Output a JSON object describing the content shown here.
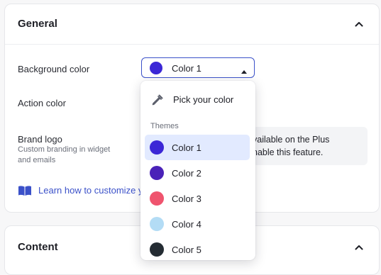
{
  "general": {
    "title": "General",
    "background_color": {
      "label": "Background color",
      "selected": "Color 1",
      "selected_hex": "#3b27d6"
    },
    "action_color": {
      "label": "Action color"
    },
    "brand_logo": {
      "label": "Brand logo",
      "sublabel": "Custom branding in widget and emails"
    },
    "upsell": {
      "line1": "vailable on the Plus",
      "line2": "nable this feature."
    },
    "learn_link": "Learn how to customize y"
  },
  "content": {
    "title": "Content"
  },
  "dropdown": {
    "pick_label": "Pick your color",
    "themes_label": "Themes",
    "options": [
      {
        "label": "Color 1",
        "hex": "#3b27d6",
        "active": true
      },
      {
        "label": "Color 2",
        "hex": "#4a22b8",
        "active": false
      },
      {
        "label": "Color 3",
        "hex": "#ef546e",
        "active": false
      },
      {
        "label": "Color 4",
        "hex": "#b3dcf5",
        "active": false
      },
      {
        "label": "Color 5",
        "hex": "#242c33",
        "active": false
      }
    ]
  },
  "colors": {
    "accent": "#3b51c9",
    "active_option_bg": "#e2eaff"
  },
  "icons": {
    "collapse": "chevron-up-icon",
    "caret": "caret-up-icon",
    "picker": "eyedropper-icon",
    "learn": "book-icon"
  }
}
